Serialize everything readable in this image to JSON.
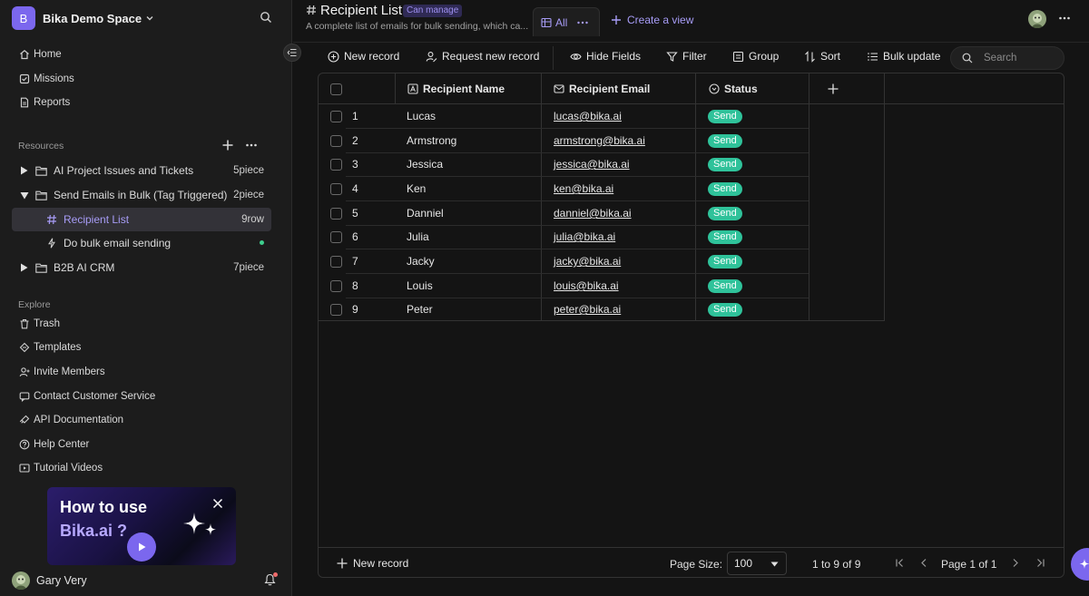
{
  "sidebar": {
    "space_initial": "B",
    "space_name": "Bika Demo Space",
    "nav": [
      {
        "label": "Home",
        "icon": "home-icon"
      },
      {
        "label": "Missions",
        "icon": "checkbox-icon"
      },
      {
        "label": "Reports",
        "icon": "document-icon"
      }
    ],
    "resources_title": "Resources",
    "resources": [
      {
        "label": "AI Project Issues and Tickets",
        "count": "5piece"
      },
      {
        "label": "Send Emails in Bulk (Tag Triggered)",
        "count": "2piece"
      },
      {
        "label": "Recipient List",
        "count": "9row"
      },
      {
        "label": "Do bulk email sending",
        "count": ""
      },
      {
        "label": "B2B AI CRM",
        "count": "7piece"
      }
    ],
    "explore_title": "Explore",
    "explore": [
      {
        "label": "Trash",
        "icon": "trash-icon"
      },
      {
        "label": "Templates",
        "icon": "templates-icon"
      },
      {
        "label": "Invite Members",
        "icon": "invite-icon"
      },
      {
        "label": "Contact Customer Service",
        "icon": "chat-icon"
      },
      {
        "label": "API Documentation",
        "icon": "api-icon"
      },
      {
        "label": "Help Center",
        "icon": "help-icon"
      },
      {
        "label": "Tutorial Videos",
        "icon": "video-icon"
      }
    ],
    "promo": {
      "line1": "How to use",
      "line2": "Bika.ai ?"
    },
    "user_name": "Gary Very"
  },
  "header": {
    "title": "Recipient List",
    "permission": "Can manage",
    "description": "A complete list of emails for bulk sending, which ca...",
    "view_tab": "All",
    "create_view": "Create a view"
  },
  "toolbar": {
    "new_record": "New record",
    "request_record": "Request new record",
    "hide_fields": "Hide Fields",
    "filter": "Filter",
    "group": "Group",
    "sort": "Sort",
    "bulk_update": "Bulk update",
    "search_placeholder": "Search"
  },
  "table": {
    "columns": [
      "Recipient Name",
      "Recipient Email",
      "Status"
    ],
    "rows": [
      {
        "n": "1",
        "name": "Lucas",
        "email": "lucas@bika.ai",
        "status": "Send"
      },
      {
        "n": "2",
        "name": "Armstrong",
        "email": "armstrong@bika.ai",
        "status": "Send"
      },
      {
        "n": "3",
        "name": "Jessica",
        "email": "jessica@bika.ai",
        "status": "Send"
      },
      {
        "n": "4",
        "name": "Ken",
        "email": "ken@bika.ai",
        "status": "Send"
      },
      {
        "n": "5",
        "name": "Danniel",
        "email": "danniel@bika.ai",
        "status": "Send"
      },
      {
        "n": "6",
        "name": "Julia",
        "email": "julia@bika.ai",
        "status": "Send"
      },
      {
        "n": "7",
        "name": "Jacky",
        "email": "jacky@bika.ai",
        "status": "Send"
      },
      {
        "n": "8",
        "name": "Louis",
        "email": "louis@bika.ai",
        "status": "Send"
      },
      {
        "n": "9",
        "name": "Peter",
        "email": "peter@bika.ai",
        "status": "Send"
      }
    ]
  },
  "footer": {
    "new_record": "New record",
    "page_size_label": "Page Size:",
    "page_size": "100",
    "range": "1 to 9 of 9",
    "page_text": "Page 1 of 1"
  },
  "colors": {
    "accent": "#7b67ee",
    "status_send": "#2fc29a",
    "link": "#a093f5"
  }
}
